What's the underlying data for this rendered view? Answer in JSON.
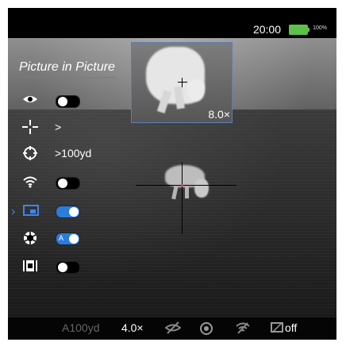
{
  "status": {
    "time": "20:00",
    "battery_label": "100%",
    "battery_color": "#5cc04a"
  },
  "menu": {
    "title": "Picture in Picture",
    "range_label": ">100yd",
    "items": [
      {
        "icon": "eye-icon",
        "toggle": "off"
      },
      {
        "icon": "crosshair-icon",
        "text": ">"
      },
      {
        "icon": "target-icon",
        "text": ">100yd"
      },
      {
        "icon": "wifi-icon",
        "toggle": "off"
      },
      {
        "icon": "pip-icon",
        "toggle": "on",
        "selected": true
      },
      {
        "icon": "aperture-icon",
        "toggle": "auto",
        "toggle_text": "A"
      },
      {
        "icon": "film-icon",
        "toggle": "off"
      }
    ]
  },
  "pip": {
    "zoom": "8.0×"
  },
  "bottombar": {
    "range": "A100yd",
    "zoom": "4.0×",
    "pip_status": "off"
  },
  "colors": {
    "accent": "#2b7cdc",
    "selector": "#3d86ec",
    "pip_border": "#5d7cb5"
  }
}
